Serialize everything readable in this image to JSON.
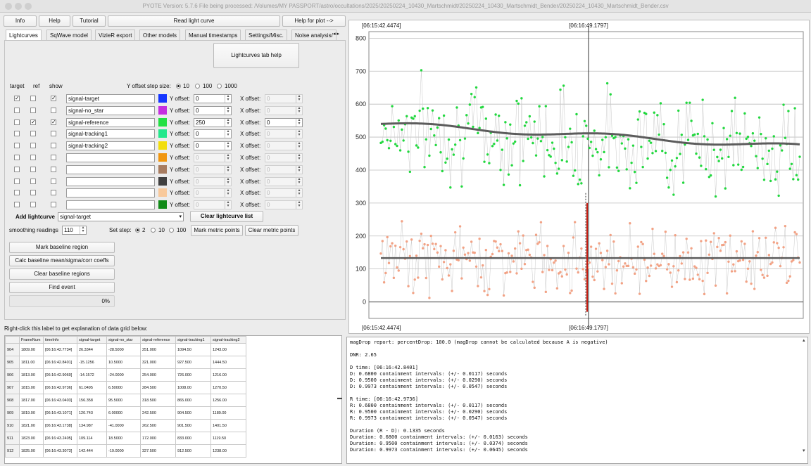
{
  "window": {
    "title": "PYOTE Version: 5.7.6  File being processed: /Volumes/MY PASSPORT/astro/occultations/2025/20250224_10430_Martschmidt/20250224_10430_Martschmidt_Bender/20250224_10430_Martschmidt_Bender.csv"
  },
  "toolbar": {
    "info": "Info",
    "help": "Help",
    "tutorial": "Tutorial",
    "read": "Read light curve",
    "plot_help": "Help for plot -->"
  },
  "tabs": [
    "Lightcurves",
    "SqWave model",
    "VizieR export",
    "Other models",
    "Manual timestamps",
    "Settings/Misc.",
    "Noise analysis/"
  ],
  "tabs_scroll": "◂ ▸",
  "lc": {
    "tab_help": "Lightcurves tab help",
    "col_target": "target",
    "col_ref": "ref",
    "col_show": "show",
    "y_step_label": "Y offset step size:",
    "step_opts": [
      "10",
      "100",
      "1000"
    ],
    "y_off": "Y offset:",
    "x_off": "X offset:",
    "rows": [
      {
        "target": true,
        "ref": false,
        "show": true,
        "name": "signal-target",
        "color": "#1435ff",
        "y": "0",
        "x": "0",
        "ye": true,
        "xe": false
      },
      {
        "target": false,
        "ref": false,
        "show": false,
        "name": "signal-no_star",
        "color": "#c52fe0",
        "y": "0",
        "x": "0",
        "ye": true,
        "xe": false
      },
      {
        "target": false,
        "ref": true,
        "show": true,
        "name": "signal-reference",
        "color": "#22e043",
        "y": "250",
        "x": "0",
        "ye": true,
        "xe": true
      },
      {
        "target": false,
        "ref": false,
        "show": false,
        "name": "signal-tracking1",
        "color": "#22e88c",
        "y": "0",
        "x": "0",
        "ye": true,
        "xe": false
      },
      {
        "target": false,
        "ref": false,
        "show": false,
        "name": "signal-tracking2",
        "color": "#f2de0c",
        "y": "0",
        "x": "0",
        "ye": true,
        "xe": false
      },
      {
        "target": false,
        "ref": false,
        "show": false,
        "name": "",
        "color": "#f0960f",
        "y": "0",
        "x": "0",
        "ye": false,
        "xe": false
      },
      {
        "target": false,
        "ref": false,
        "show": false,
        "name": "",
        "color": "#a77c60",
        "y": "0",
        "x": "0",
        "ye": false,
        "xe": false
      },
      {
        "target": false,
        "ref": false,
        "show": false,
        "name": "",
        "color": "#404040",
        "y": "0",
        "x": "0",
        "ye": false,
        "xe": false
      },
      {
        "target": false,
        "ref": false,
        "show": false,
        "name": "",
        "color": "#f8c99b",
        "y": "0",
        "x": "0",
        "ye": false,
        "xe": false
      },
      {
        "target": false,
        "ref": false,
        "show": false,
        "name": "",
        "color": "#118a18",
        "y": "0",
        "x": "0",
        "ye": false,
        "xe": false
      }
    ],
    "add_label": "Add lightcurve",
    "add_value": "signal-target",
    "clear_list": "Clear lightcurve list",
    "smooth_label": "smoothing readings",
    "smooth_value": "110",
    "set_step_label": "Set step:",
    "set_step_opts": [
      "2",
      "10",
      "100"
    ],
    "mark_metric": "Mark metric points",
    "clear_metric": "Clear metric points",
    "mark_baseline": "Mark baseline region",
    "calc_baseline": "Calc baseline mean/sigma/corr coeffs",
    "clear_baseline": "Clear baseline regions",
    "find_event": "Find event",
    "progress": "0%"
  },
  "grid_hint": "Right-click this label to get explanation of data grid below:",
  "grid": {
    "headers": [
      "FrameNum",
      "timeInfo",
      "signal-target",
      "signal-no_star",
      "signal-reference",
      "signal-tracking1",
      "signal-tracking2"
    ],
    "rows": [
      [
        "904",
        "1809.00",
        "[06:16:42.7734]",
        "26.3344",
        "-28.5000",
        "251.000",
        "1094.50",
        "1243.00"
      ],
      [
        "905",
        "1811.00",
        "[06:16:42.8401]",
        "-15.1256",
        "10.5000",
        "321.000",
        "927.500",
        "1444.50"
      ],
      [
        "906",
        "1813.00",
        "[06:16:42.9069]",
        "-14.1572",
        "-24.0000",
        "254.000",
        "726.000",
        "1216.00"
      ],
      [
        "907",
        "1815.00",
        "[06:16:42.9736]",
        "61.0495",
        "6.50000",
        "284.500",
        "1008.00",
        "1270.50"
      ],
      [
        "908",
        "1817.00",
        "[06:16:43.0403]",
        "156.358",
        "95.5000",
        "318.500",
        "865.000",
        "1256.00"
      ],
      [
        "909",
        "1819.00",
        "[06:16:43.1071]",
        "120.743",
        "6.00000",
        "242.500",
        "904.500",
        "1189.00"
      ],
      [
        "910",
        "1821.00",
        "[06:16:43.1738]",
        "134.987",
        "-41.0000",
        "262.500",
        "901.500",
        "1401.50"
      ],
      [
        "911",
        "1823.00",
        "[06:16:43.2405]",
        "109.114",
        "18.5000",
        "172.000",
        "833.000",
        "1119.50"
      ],
      [
        "912",
        "1825.00",
        "[06:16:43.3073]",
        "142.444",
        "-19.0000",
        "327.500",
        "912.500",
        "1238.00"
      ]
    ]
  },
  "report": [
    "magDrop report: percentDrop: 100.0 (magDrop cannot be calculated because A is negative)",
    "",
    "DNR: 2.65",
    "",
    "D time: [06:16:42.8401]",
    "D: 0.6800 containment intervals: (+/- 0.0117) seconds",
    "D: 0.9500 containment intervals: (+/- 0.0290) seconds",
    "D: 0.9973 containment intervals: (+/- 0.0547) seconds",
    "",
    "R time: [06:16:42.9736]",
    "R: 0.6800 containment intervals: (+/- 0.0117) seconds",
    "R: 0.9500 containment intervals: (+/- 0.0290) seconds",
    "R: 0.9973 containment intervals: (+/- 0.0547) seconds",
    "",
    "Duration (R - D): 0.1335 seconds",
    "Duration: 0.6800 containment intervals: (+/- 0.0163) seconds",
    "Duration: 0.9500 containment intervals: (+/- 0.0374) seconds",
    "Duration: 0.9973 containment intervals: (+/- 0.0645) seconds"
  ],
  "chart_data": {
    "type": "scatter",
    "ylim": [
      -50,
      820
    ],
    "yticks": [
      "0",
      "100",
      "200",
      "300",
      "400",
      "500",
      "600",
      "700",
      "800"
    ],
    "xlabels": {
      "left": "[06:15:42.4474]",
      "cursor": "[06:16:49.1797]"
    },
    "series": [
      {
        "name": "signal-reference",
        "mean": 530,
        "spread": 110
      },
      {
        "name": "signal-target",
        "mean": 130,
        "spread": 75
      }
    ],
    "colors": {
      "reference": "#22d83f",
      "target": "#f2a285",
      "smooth": "#5c5c5c",
      "event": "#c11a0f"
    }
  }
}
